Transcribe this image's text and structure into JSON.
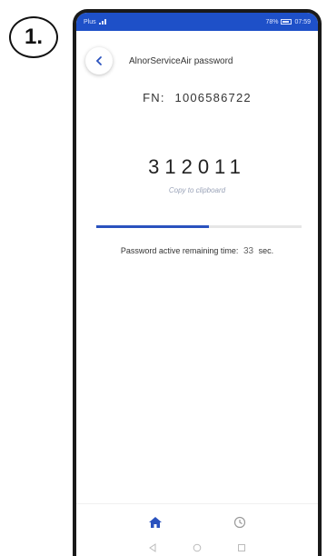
{
  "step": {
    "label": "1."
  },
  "status_bar": {
    "left": "Plus",
    "right": "78%",
    "time": "07:59"
  },
  "header": {
    "title": "AlnorServiceAir password"
  },
  "fn": {
    "label": "FN:",
    "value": "1006586722"
  },
  "password": {
    "code": "312011",
    "copy_label": "Copy to clipboard"
  },
  "timer": {
    "progress": 0.55,
    "label": "Password active remaining time:",
    "seconds": "33",
    "unit": "sec."
  },
  "colors": {
    "accent": "#2a52be",
    "status_bar": "#1e50c8"
  },
  "nav": {
    "items": [
      "home-icon",
      "history-icon"
    ]
  },
  "system_nav": {
    "items": [
      "back-triangle-icon",
      "home-circle-icon",
      "recents-square-icon"
    ]
  }
}
